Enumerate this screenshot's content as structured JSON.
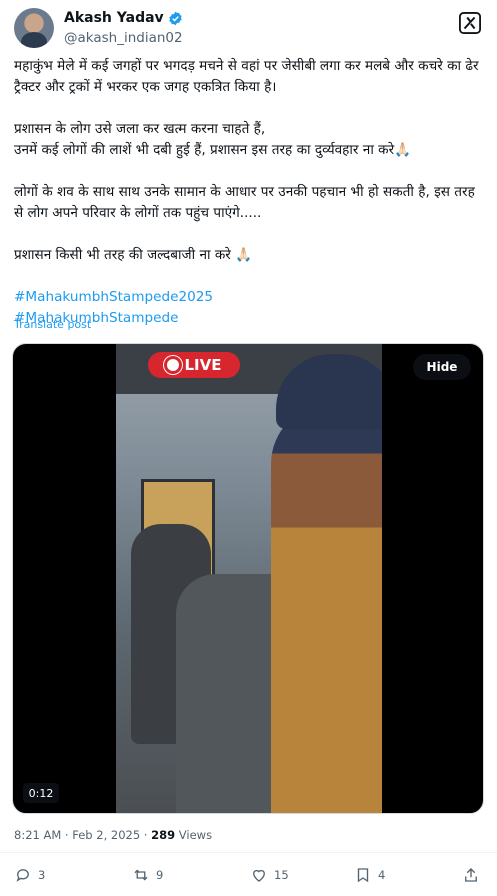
{
  "author": {
    "name": "Akash Yadav",
    "handle": "@akash_indian02"
  },
  "post": {
    "paragraphs": [
      "महाकुंभ मेले में कई जगहों पर भगदड़ मचने से वहां पर जेसीबी लगा कर मलबे और कचरे का ढेर ट्रैक्टर और ट्रकों में भरकर एक जगह एकत्रित किया है।",
      "प्रशासन के लोग उसे जला कर खत्म करना चाहते हैं,\nउनमें कई लोगों की लाशें भी दबी हुई हैं, प्रशासन इस तरह का दुर्व्यवहार ना करे🙏🏻",
      "लोगों के शव के साथ साथ उनके सामान के आधार पर उनकी पहचान भी हो सकती है, इस तरह से लोग अपने परिवार के लोगों तक पहुंच पाएंगे.....",
      "प्रशासन किसी भी तरह की जल्दबाजी ना करे 🙏🏻"
    ],
    "hashtags": [
      "#MahakumbhStampede2025",
      "#MahakumbhStampede"
    ],
    "translate_label": "Translate post"
  },
  "media": {
    "live_label": "LIVE",
    "hide_label": "Hide",
    "timer": "0:12"
  },
  "meta": {
    "time_date": "8:21 AM · Feb 2, 2025 · ",
    "views_count": "289",
    "views_label": " Views"
  },
  "actions": {
    "replies": "3",
    "reposts": "9",
    "likes": "15",
    "bookmarks": "4"
  },
  "colors": {
    "accent": "#1d9bf0",
    "live": "#d8262f",
    "muted": "#536471"
  }
}
